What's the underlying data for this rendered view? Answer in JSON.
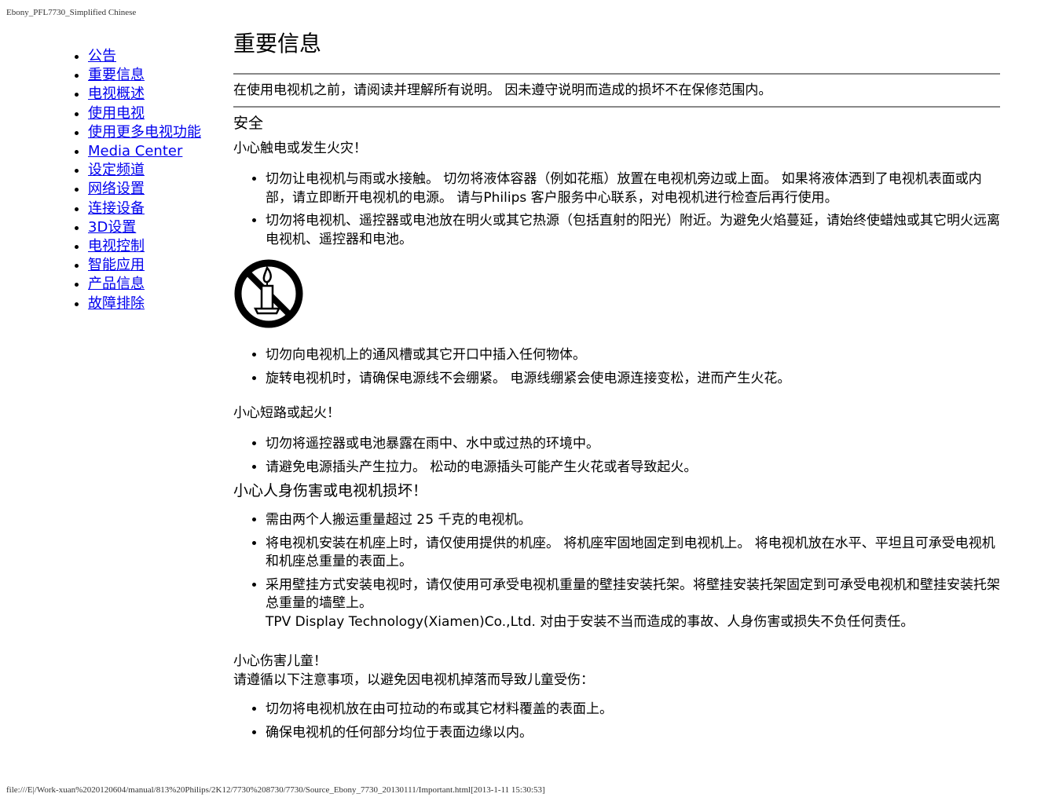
{
  "header": {
    "doc_title": "Ebony_PFL7730_Simplified Chinese"
  },
  "nav": {
    "items": [
      "公告",
      "重要信息",
      "电视概述",
      "使用电视",
      "使用更多电视功能",
      "Media Center",
      "设定频道",
      "网络设置",
      "连接设备",
      "3D设置",
      "电视控制",
      "智能应用",
      "产品信息",
      "故障排除"
    ]
  },
  "main": {
    "title": "重要信息",
    "intro": "在使用电视机之前，请阅读并理解所有说明。 因未遵守说明而造成的损坏不在保修范围内。",
    "safety_heading": "安全",
    "fire": {
      "heading": "小心触电或发生火灾！",
      "items_a": [
        "切勿让电视机与雨或水接触。 切勿将液体容器（例如花瓶）放置在电视机旁边或上面。 如果将液体洒到了电视机表面或内部，请立即断开电视机的电源。 请与Philips 客户服务中心联系，对电视机进行检查后再行使用。",
        "切勿将电视机、遥控器或电池放在明火或其它热源（包括直射的阳光）附近。为避免火焰蔓延，请始终使蜡烛或其它明火远离电视机、遥控器和电池。"
      ],
      "icon": "no-candle-icon",
      "items_b": [
        "切勿向电视机上的通风槽或其它开口中插入任何物体。",
        "旋转电视机时，请确保电源线不会绷紧。 电源线绷紧会使电源连接变松，进而产生火花。"
      ]
    },
    "short": {
      "heading": "小心短路或起火！",
      "items": [
        "切勿将遥控器或电池暴露在雨中、水中或过热的环境中。",
        "请避免电源插头产生拉力。 松动的电源插头可能产生火花或者导致起火。"
      ]
    },
    "injury": {
      "heading": "小心人身伤害或电视机损坏！",
      "items": [
        "需由两个人搬运重量超过 25 千克的电视机。",
        "将电视机安装在机座上时，请仅使用提供的机座。 将机座牢固地固定到电视机上。 将电视机放在水平、平坦且可承受电视机和机座总重量的表面上。",
        "采用壁挂方式安装电视时，请仅使用可承受电视机重量的壁挂安装托架。将壁挂安装托架固定到可承受电视机和壁挂安装托架总重量的墙壁上。"
      ],
      "disclaimer": "TPV Display Technology(Xiamen)Co.,Ltd. 对由于安装不当而造成的事故、人身伤害或损失不负任何责任。"
    },
    "children": {
      "heading": "小心伤害儿童！",
      "intro": "请遵循以下注意事项，以避免因电视机掉落而导致儿童受伤：",
      "items": [
        "切勿将电视机放在由可拉动的布或其它材料覆盖的表面上。",
        "确保电视机的任何部分均位于表面边缘以内。"
      ]
    }
  },
  "footer": {
    "path": "file:///E|/Work-xuan%2020120604/manual/813%20Philips/2K12/7730%208730/7730/Source_Ebony_7730_20130111/Important.html[2013-1-11 15:30:53]"
  }
}
